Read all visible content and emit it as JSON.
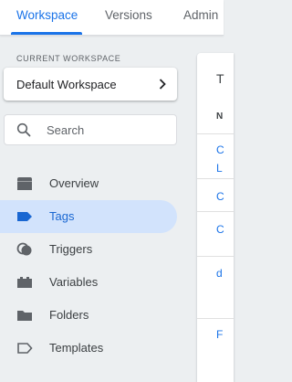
{
  "tabs": [
    {
      "label": "Workspace",
      "active": true
    },
    {
      "label": "Versions",
      "active": false
    },
    {
      "label": "Admin",
      "active": false
    }
  ],
  "workspace": {
    "section_label": "CURRENT WORKSPACE",
    "name": "Default Workspace"
  },
  "search": {
    "placeholder": "Search"
  },
  "nav": {
    "items": [
      {
        "label": "Overview",
        "icon": "overview-icon"
      },
      {
        "label": "Tags",
        "icon": "tag-icon",
        "active": true
      },
      {
        "label": "Triggers",
        "icon": "triggers-icon"
      },
      {
        "label": "Variables",
        "icon": "variables-icon"
      },
      {
        "label": "Folders",
        "icon": "folder-icon"
      },
      {
        "label": "Templates",
        "icon": "template-icon"
      }
    ]
  },
  "panel": {
    "header_char": "T",
    "column_char": "N",
    "rows": [
      "C",
      "L",
      "C",
      "C",
      "d",
      "F"
    ]
  },
  "colors": {
    "accent": "#1a73e8",
    "active_nav_bg": "#d2e3fc",
    "background": "#eceff1"
  }
}
